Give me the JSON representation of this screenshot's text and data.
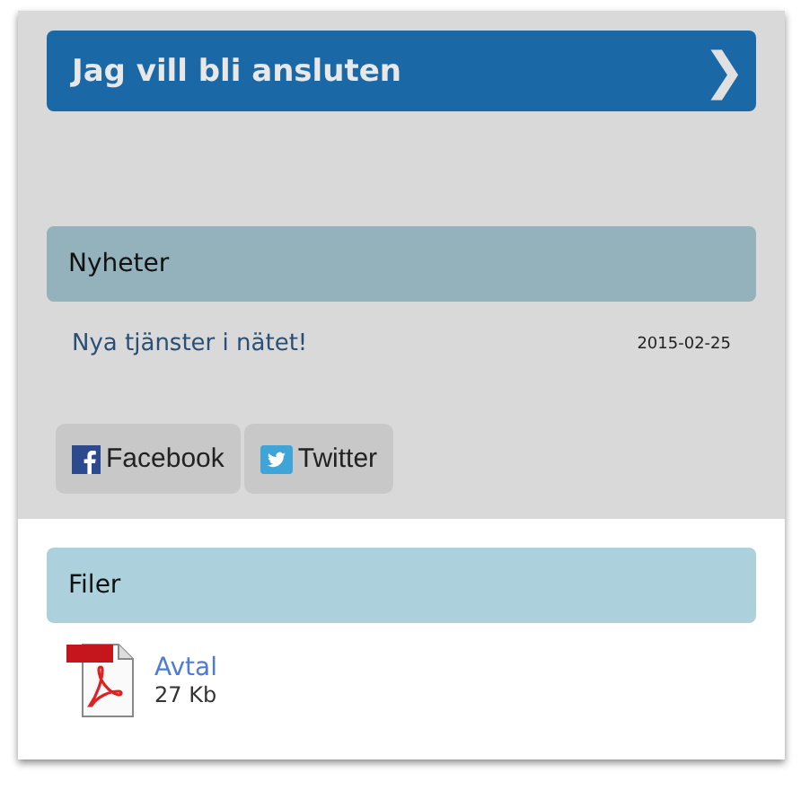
{
  "cta_button": {
    "label": "Jag vill bli ansluten",
    "arrow": "❯"
  },
  "news": {
    "title": "Nyheter",
    "items": [
      {
        "headline": "Nya tjänster i nätet!",
        "date": "2015-02-25"
      }
    ]
  },
  "share_buttons": [
    {
      "kind": "facebook",
      "label": "Facebook"
    },
    {
      "kind": "twitter",
      "label": "Twitter"
    }
  ],
  "files": {
    "title": "Filer",
    "items": [
      {
        "name": "Avtal",
        "size": "27 Kb"
      }
    ]
  }
}
